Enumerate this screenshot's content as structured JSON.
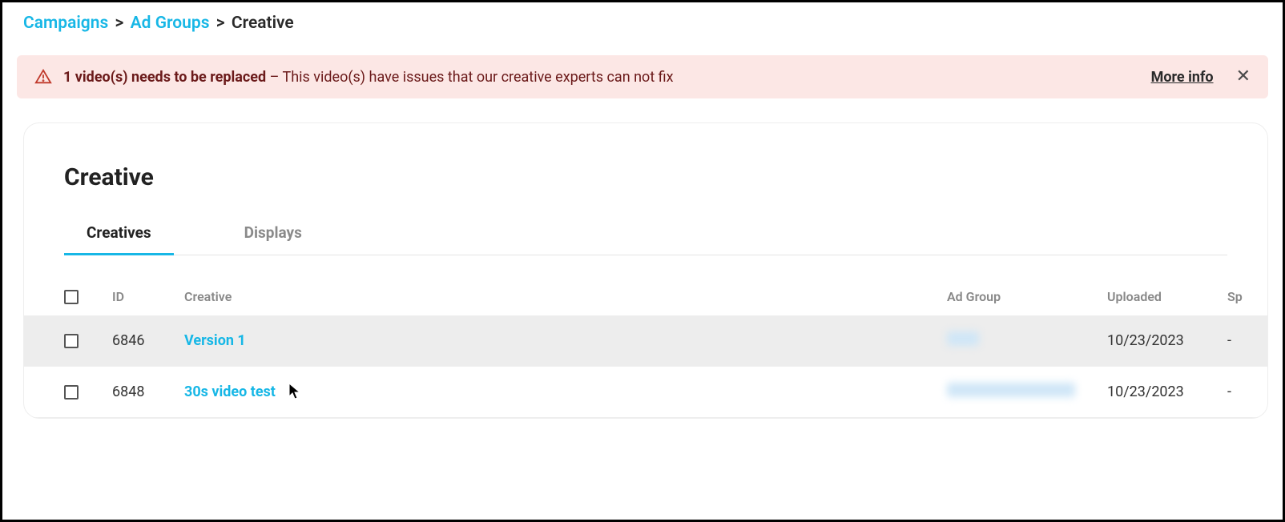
{
  "breadcrumb": {
    "campaigns": "Campaigns",
    "adgroups": "Ad Groups",
    "current": "Creative"
  },
  "alert": {
    "bold": "1 video(s) needs to be replaced",
    "rest": " – This video(s) have issues that our creative experts can not fix",
    "more": "More info"
  },
  "page_title": "Creative",
  "tabs": {
    "creatives": "Creatives",
    "displays": "Displays"
  },
  "columns": {
    "id": "ID",
    "creative": "Creative",
    "adgroup": "Ad Group",
    "uploaded": "Uploaded",
    "sp": "Sp"
  },
  "rows": [
    {
      "id": "6846",
      "name": "Version 1",
      "uploaded": "10/23/2023",
      "sp": "-",
      "blur": "small"
    },
    {
      "id": "6848",
      "name": "30s video test",
      "uploaded": "10/23/2023",
      "sp": "-",
      "blur": "large"
    }
  ]
}
